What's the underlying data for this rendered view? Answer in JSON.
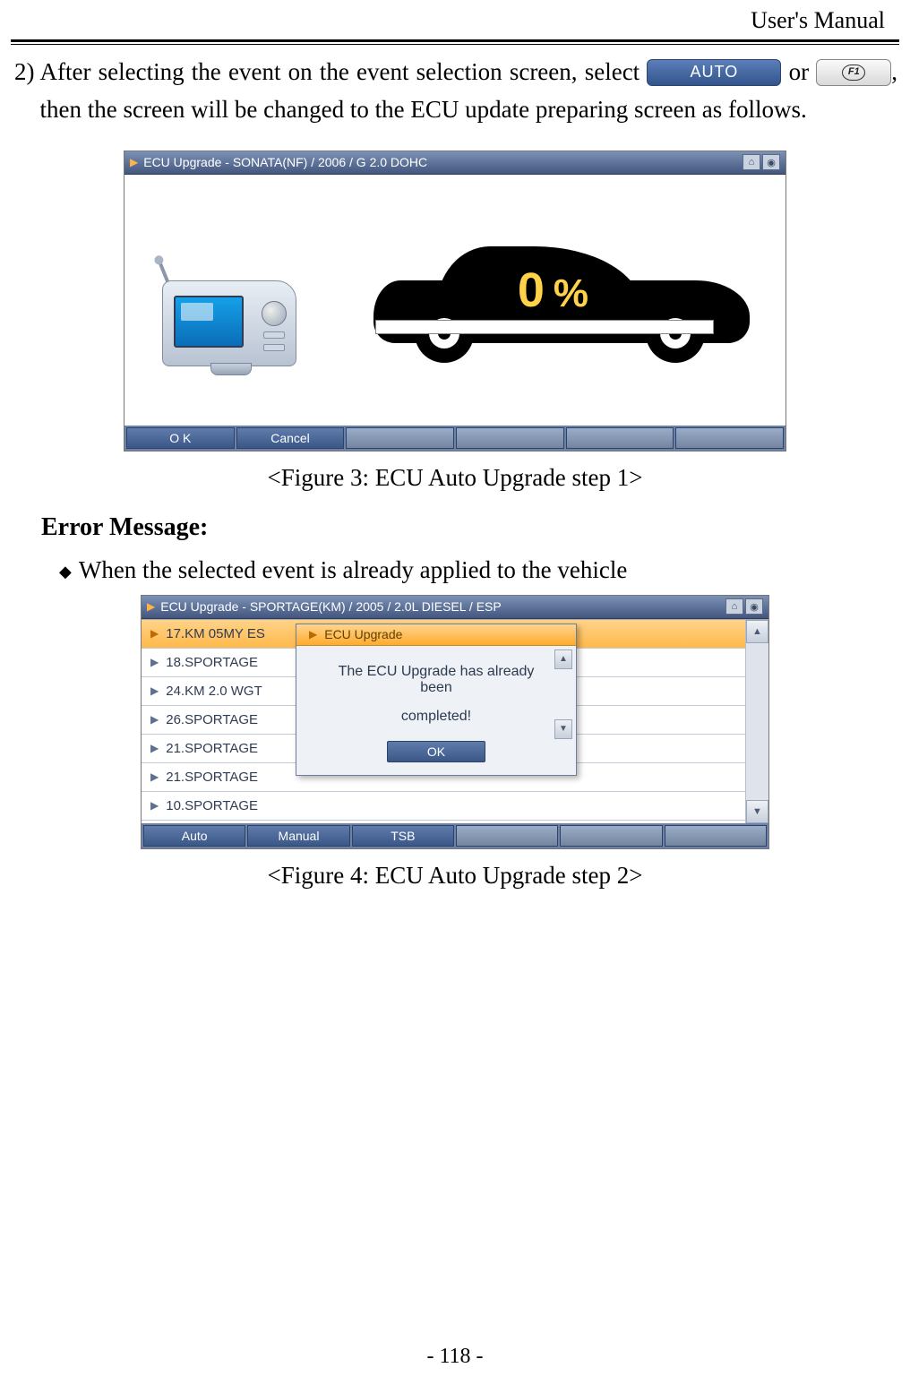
{
  "header": {
    "title": "User's Manual"
  },
  "step": {
    "number": "2)",
    "text_before_auto": "After selecting the event on the event selection screen, select",
    "auto_label": "AUTO",
    "or_word": " or ",
    "f1_label": "F1",
    "text_after": ", then the screen will be changed to the ECU update preparing screen as follows."
  },
  "fig1": {
    "titlebar": "ECU Upgrade - SONATA(NF) / 2006 / G 2.0 DOHC",
    "percent_value": "0",
    "percent_sign": "%",
    "buttons": {
      "ok": "O K",
      "cancel": "Cancel"
    },
    "caption": "<Figure 3: ECU Auto Upgrade step 1>"
  },
  "error_section": {
    "heading": "Error Message:",
    "bullet": "When the selected event is already applied to the vehicle"
  },
  "fig2": {
    "titlebar": "ECU Upgrade - SPORTAGE(KM) / 2005 / 2.0L DIESEL / ESP",
    "rows": [
      "17.KM 05MY ES",
      "18.SPORTAGE",
      "24.KM 2.0 WGT",
      "26.SPORTAGE",
      "21.SPORTAGE",
      "21.SPORTAGE",
      "10.SPORTAGE"
    ],
    "dialog": {
      "title": "ECU Upgrade",
      "line1": "The ECU Upgrade has already",
      "line2": "been",
      "line3": "completed!",
      "ok": "OK"
    },
    "buttons": {
      "auto": "Auto",
      "manual": "Manual",
      "tsb": "TSB"
    },
    "caption": "<Figure 4: ECU Auto Upgrade step 2>"
  },
  "page_number": "- 118 -"
}
